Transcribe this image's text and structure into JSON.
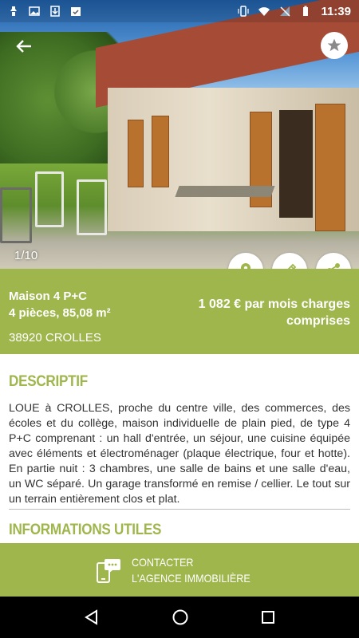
{
  "status_bar": {
    "time": "11:39",
    "left_icons": [
      "notification-icon",
      "image-icon",
      "download-icon",
      "clipboard-check-icon"
    ],
    "right_icons": [
      "vibrate-icon",
      "wifi-icon",
      "no-sim-icon",
      "battery-icon"
    ]
  },
  "gallery": {
    "counter": "1/10"
  },
  "listing": {
    "type": "Maison 4 P+C",
    "rooms_area": "4 pièces, 85,08 m²",
    "location": "38920 CROLLES",
    "price": "1 082 € par mois charges comprises"
  },
  "description": {
    "title": "DESCRIPTIF",
    "text": "LOUE à CROLLES, proche du centre ville, des commerces, des écoles et du collège, maison individuelle de plain pied, de type 4 P+C comprenant : un hall d'entrée, un séjour, une cuisine équipée avec éléments et électroménager (plaque électrique, four et hotte). En partie nuit : 3 chambres, une salle de bains et une salle d'eau, un WC séparé. Un garage transformé en remise / cellier. Le tout sur un terrain entièrement clos et plat."
  },
  "useful_info": {
    "title": "INFORMATIONS UTILES"
  },
  "contact": {
    "line1": "CONTACTER",
    "line2": "L'AGENCE IMMOBILIÈRE"
  },
  "colors": {
    "accent": "#9fb64c",
    "text": "#333333",
    "navbar": "#000000"
  }
}
